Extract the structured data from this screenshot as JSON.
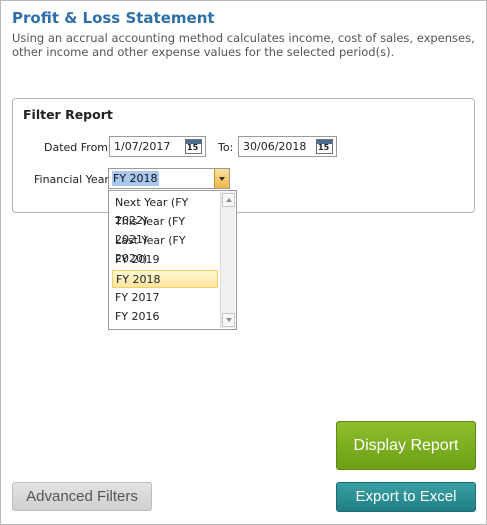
{
  "header": {
    "title": "Profit & Loss Statement",
    "description": "Using an accrual accounting method calculates income, cost of sales, expenses, other income and other expense values for the selected period(s)."
  },
  "filter": {
    "title": "Filter Report",
    "dated_from_label": "Dated From:",
    "dated_from_value": "1/07/2017",
    "to_label": "To:",
    "to_value": "30/06/2018",
    "calendar_day": "15",
    "financial_year_label": "Financial Year:",
    "financial_year_value": "FY 2018"
  },
  "dropdown": {
    "options": [
      "Next Year (FY 2022)",
      "This Year (FY 2021)",
      "Last Year (FY 2020)",
      "FY 2019",
      "FY 2018",
      "FY 2017",
      "FY 2016"
    ],
    "selected": "FY 2018"
  },
  "buttons": {
    "display_report": "Display Report",
    "export_to_excel": "Export to Excel",
    "advanced_filters": "Advanced Filters"
  },
  "colors": {
    "title": "#2f6fa8",
    "display_button": "#7aac1f",
    "export_button": "#2a8d91",
    "advanced_button": "#d9d9d9",
    "dropdown_highlight": "#fce79c"
  }
}
